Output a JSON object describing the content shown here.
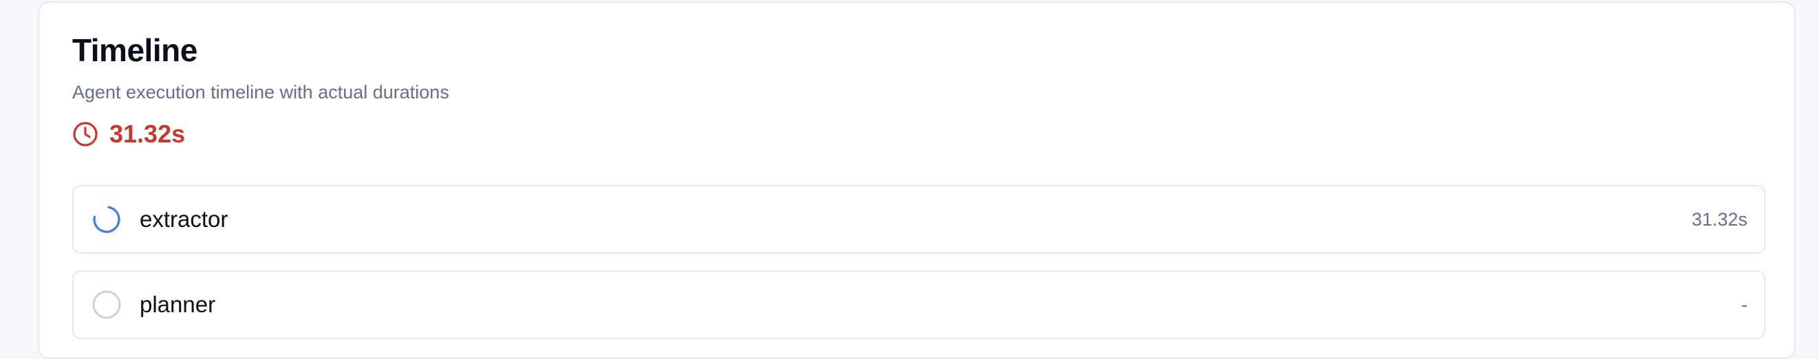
{
  "card": {
    "title": "Timeline",
    "subtitle": "Agent execution timeline with actual durations"
  },
  "total": {
    "icon": "clock-icon",
    "value": "31.32s",
    "color": "#c53a30"
  },
  "agents": [
    {
      "name": "extractor",
      "duration": "31.32s",
      "status": "running",
      "icon": "spinner-icon",
      "color": "#4a7ee0"
    },
    {
      "name": "planner",
      "duration": "-",
      "status": "pending",
      "icon": "empty-circle-icon",
      "color": "#cdd1d8"
    }
  ]
}
